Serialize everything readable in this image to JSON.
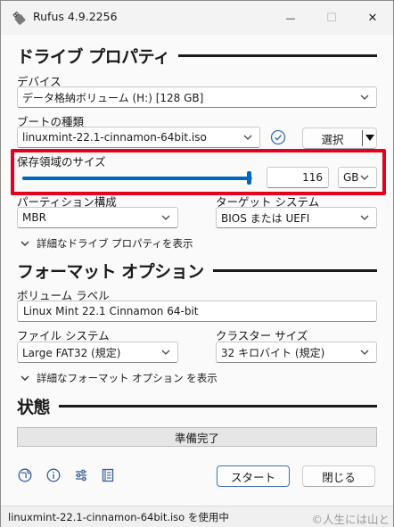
{
  "window": {
    "title": "Rufus 4.9.2256",
    "minimize_glyph": "—",
    "maximize_glyph": "☐",
    "close_glyph": "✕"
  },
  "drive_properties": {
    "heading": "ドライブ プロパティ",
    "device_label": "デバイス",
    "device_value": "データ格納ボリューム (H:) [128 GB]",
    "boot_label": "ブートの種類",
    "boot_value": "linuxmint-22.1-cinnamon-64bit.iso",
    "select_button": "選択",
    "persistent_label": "保存領域のサイズ",
    "persistent_value": "116",
    "persistent_fraction": 0.985,
    "persistent_unit": "GB",
    "partition_label": "パーティション構成",
    "partition_value": "MBR",
    "target_label": "ターゲット システム",
    "target_value": "BIOS または UEFI",
    "advanced_toggle": "詳細なドライブ プロパティを表示"
  },
  "format_options": {
    "heading": "フォーマット オプション",
    "volume_label": "ボリューム ラベル",
    "volume_value": "Linux Mint 22.1 Cinnamon 64-bit",
    "fs_label": "ファイル システム",
    "fs_value": "Large FAT32 (規定)",
    "cluster_label": "クラスター サイズ",
    "cluster_value": "32 キロバイト (規定)",
    "advanced_toggle": "詳細なフォーマット オプション を表示"
  },
  "status": {
    "heading": "状態",
    "progress_text": "準備完了"
  },
  "actions": {
    "start_button": "スタート",
    "close_button": "閉じる"
  },
  "footer": {
    "status_text": "linuxmint-22.1-cinnamon-64bit.iso を使用中",
    "watermark": "©人生には山と"
  },
  "icons": {
    "app": "usb-drive-icon",
    "language": "globe-icon",
    "about": "info-icon",
    "settings": "sliders-icon",
    "log": "log-icon",
    "hash": "check-circle-icon"
  },
  "colors": {
    "accent": "#0067c0",
    "highlight": "#e6001f"
  }
}
